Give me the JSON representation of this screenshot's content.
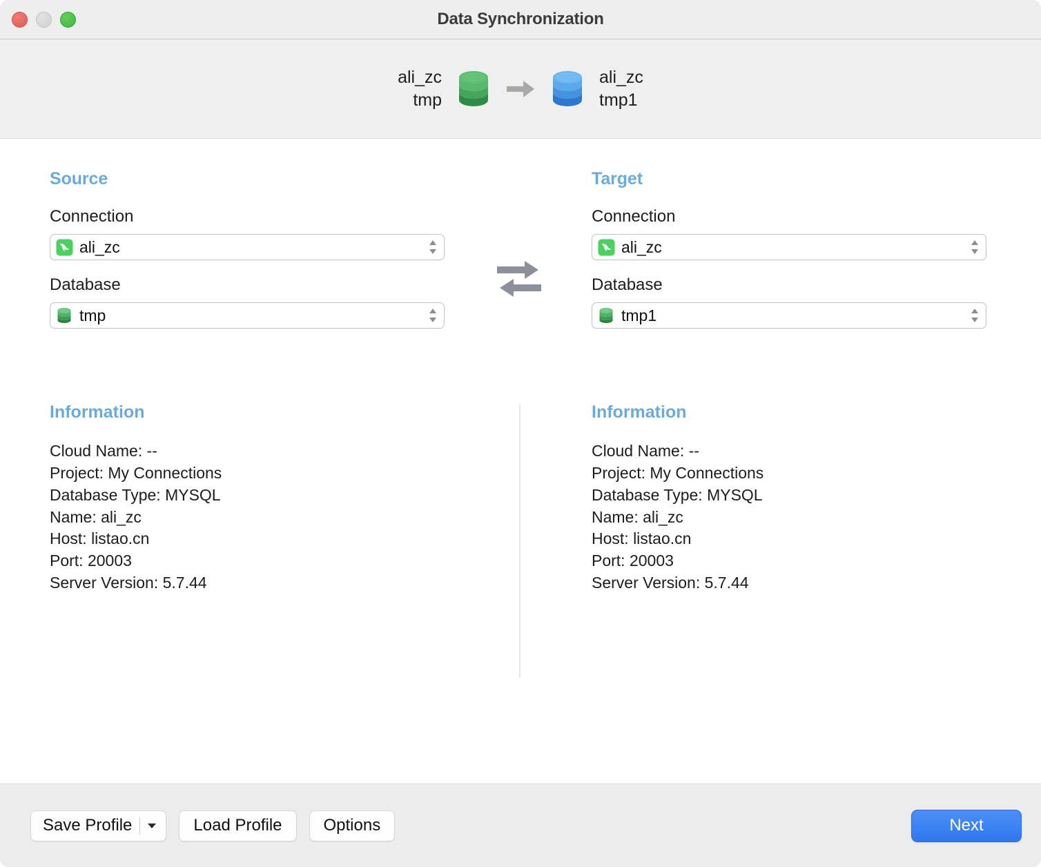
{
  "window": {
    "title": "Data Synchronization",
    "traffic_lights": [
      "close-button",
      "minimize-button",
      "maximize-button"
    ]
  },
  "header_flow": {
    "source": {
      "connection": "ali_zc",
      "database": "tmp",
      "icon": "database-cylinder-green-icon",
      "color": "#43a85f"
    },
    "arrow_icon": "arrow-right-icon",
    "target": {
      "connection": "ali_zc",
      "database": "tmp1",
      "icon": "database-cylinder-blue-icon",
      "color": "#3f8ede"
    }
  },
  "source": {
    "heading": "Source",
    "connection_label": "Connection",
    "connection_value": "ali_zc",
    "connection_icon": "mysql-dolphin-icon",
    "database_label": "Database",
    "database_value": "tmp",
    "database_icon": "database-cylinder-green-icon"
  },
  "target": {
    "heading": "Target",
    "connection_label": "Connection",
    "connection_value": "ali_zc",
    "connection_icon": "mysql-dolphin-icon",
    "database_label": "Database",
    "database_value": "tmp1",
    "database_icon": "database-cylinder-green-icon"
  },
  "swap_icon": "swap-arrows-icon",
  "information_source": {
    "heading": "Information",
    "lines": [
      "Cloud Name: --",
      "Project: My Connections",
      "Database Type: MYSQL",
      "Name: ali_zc",
      "Host: listao.cn",
      "Port: 20003",
      "Server Version: 5.7.44"
    ]
  },
  "information_target": {
    "heading": "Information",
    "lines": [
      "Cloud Name: --",
      "Project: My Connections",
      "Database Type: MYSQL",
      "Name: ali_zc",
      "Host: listao.cn",
      "Port: 20003",
      "Server Version: 5.7.44"
    ]
  },
  "toolbar": {
    "save_profile_label": "Save Profile",
    "save_profile_caret_icon": "chevron-down-icon",
    "load_profile_label": "Load Profile",
    "options_label": "Options",
    "next_label": "Next"
  },
  "colors": {
    "accent_heading": "#6cabd9",
    "primary_button": "#3b81f2",
    "source_db": "#43a85f",
    "target_db": "#3f8ede"
  }
}
